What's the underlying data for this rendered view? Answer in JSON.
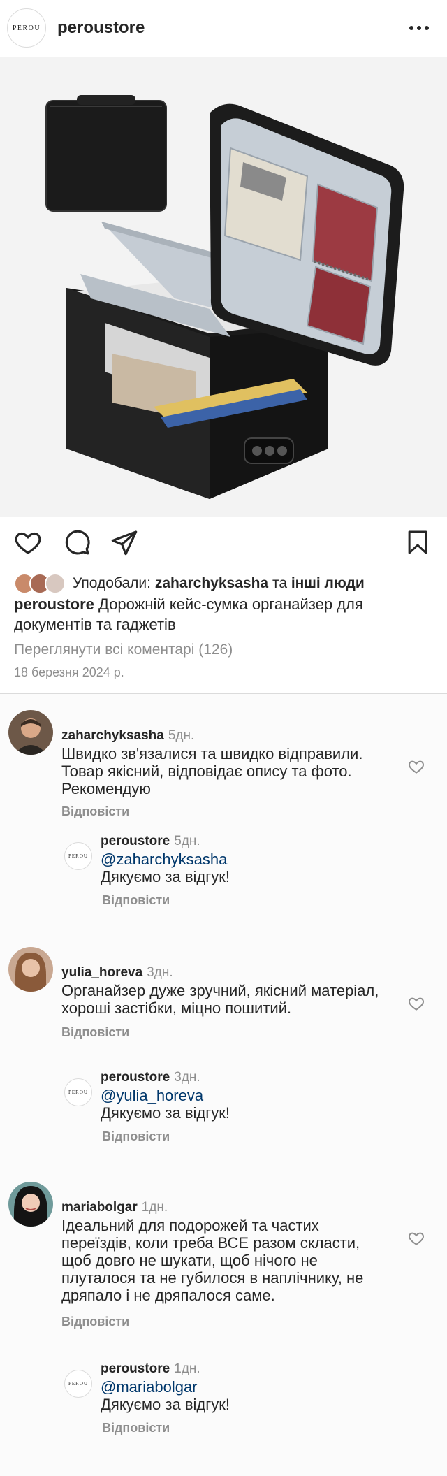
{
  "header": {
    "avatar_text": "PEROU",
    "username": "peroustore"
  },
  "post": {
    "likes_prefix": "Уподобали:",
    "likes_user": "zaharchyksasha",
    "likes_and": "та",
    "likes_others": "інші люди",
    "caption_user": "peroustore",
    "caption_text": "Дорожній кейс-сумка органайзер для документів та гаджетів",
    "view_all": "Переглянути всі коментарі (126)",
    "date": "18 березня 2024 р."
  },
  "comments": [
    {
      "author": "zaharchyksasha",
      "time": "5дн.",
      "text": "Швидко зв'язалися та швидко відправили. Товар якісний, відповідає опису та фото. Рекомендую",
      "reply_label": "Відповісти",
      "reply": {
        "avatar_text": "PEROU",
        "author": "peroustore",
        "time": "5дн.",
        "mention": "@zaharchyksasha",
        "text": "Дякуємо за відгук!",
        "reply_label": "Відповісти"
      }
    },
    {
      "author": "yulia_horeva",
      "time": "3дн.",
      "text": "Органайзер дуже зручний, якісний матеріал, хороші застібки, міцно пошитий.",
      "reply_label": "Відповісти",
      "reply": {
        "avatar_text": "PEROU",
        "author": "peroustore",
        "time": "3дн.",
        "mention": "@yulia_horeva",
        "text": "Дякуємо за відгук!",
        "reply_label": "Відповісти"
      }
    },
    {
      "author": "mariabolgar",
      "time": "1дн.",
      "text": "Ідеальний для подорожей та частих переїздів, коли треба ВСЕ разом скласти, щоб довго не шукати, щоб нічого не плуталося та не губилося в наплічнику, не дряпало і не дряпалося саме.",
      "reply_label": "Відповісти",
      "reply": {
        "avatar_text": "PEROU",
        "author": "peroustore",
        "time": "1дн.",
        "mention": "@mariabolgar",
        "text": "Дякуємо за відгук!",
        "reply_label": "Відповісти"
      }
    }
  ],
  "icons": {
    "more": "more-horizontal-icon",
    "like": "heart-icon",
    "comment": "comment-bubble-icon",
    "share": "send-paper-plane-icon",
    "save": "bookmark-icon",
    "comment_like": "small-heart-icon"
  },
  "colors": {
    "text": "#262626",
    "secondary": "#8e8e8e",
    "mention": "#00376b",
    "divider": "#dbdbdb"
  }
}
